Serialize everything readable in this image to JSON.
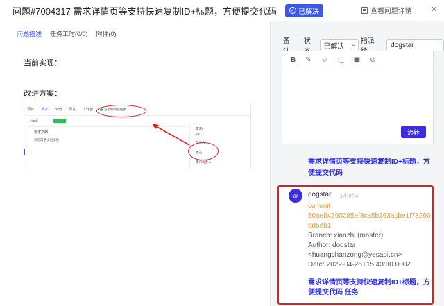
{
  "header": {
    "title": "问题#7004317  需求详情页等支持快速复制ID+标题，方便提交代码",
    "badge": "已解决",
    "view_details": "查看问题详情",
    "close": "×"
  },
  "tabs": [
    {
      "label": "问题描述",
      "active": true
    },
    {
      "label": "任务工时(0/0)",
      "active": false
    },
    {
      "label": "附件(0)",
      "active": false
    }
  ],
  "description": {
    "current": "当前实现：",
    "improvement": "改进方案："
  },
  "embed": {
    "nav": [
      "项目",
      "需求",
      "Blog",
      "研发",
      "工作台"
    ],
    "status": "已复制到粘贴板",
    "back": "← task",
    "doc_title": "需求文档",
    "doc_body": "新论需求文档模板",
    "side_labels": [
      "需求#",
      "592",
      "负责人",
      "状态",
      "需求负责人"
    ]
  },
  "right": {
    "remark_label": "备注",
    "status_label": "状态",
    "status_value": "已解决",
    "assign_label": "指派给",
    "assignee": "dogstar",
    "toolbar": [
      "B",
      "✎",
      "☺",
      "›_",
      "▣",
      "⊘"
    ],
    "flow_button": "流转",
    "prev_message": "需求详情页等支持快速复制ID+标题，方便提交代码"
  },
  "commit": {
    "avatar": "ar",
    "author": "dogstar",
    "time": "1小时前",
    "prefix": "commit",
    "hash": "50aeff4290285ef8ca5b163acbe1f78290bd5eb1",
    "branch": "Branch: xiaozhi (master)",
    "author_line": "Author: dogstar",
    "email": "<huangchanzong@yesapi.cn>",
    "date": "Date: 2022-04-26T15:43:00.000Z",
    "message": "需求详情页等支持快速复制ID+标题，方便提交代码 任务"
  },
  "colors": {
    "accent": "#3d58e8",
    "button": "#3d2fd8",
    "highlight": "#e02020",
    "hash": "#e8a020"
  }
}
